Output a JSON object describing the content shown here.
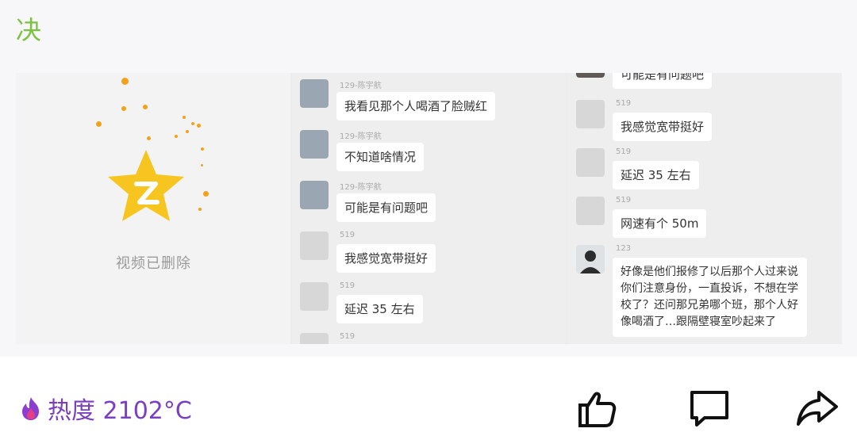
{
  "top": {
    "char": "决"
  },
  "video": {
    "deleted_text": "视频已删除"
  },
  "chat_left": [
    {
      "sender": "129-陈宇航",
      "text": "我看见那个人喝酒了脸贼红",
      "avatar": "photo-avatar"
    },
    {
      "sender": "129-陈宇航",
      "text": "不知道啥情况",
      "avatar": "photo-avatar"
    },
    {
      "sender": "129-陈宇航",
      "text": "可能是有问题吧",
      "avatar": "photo-avatar"
    },
    {
      "sender": "519",
      "text": "我感觉宽带挺好",
      "avatar": "sketch-avatar"
    },
    {
      "sender": "519",
      "text": "延迟 35 左右",
      "avatar": "sketch-avatar"
    },
    {
      "sender": "519",
      "text": "",
      "avatar": "sketch-avatar"
    }
  ],
  "chat_right": [
    {
      "sender": "",
      "text": "可能是有问题吧",
      "avatar": "photo-avatar"
    },
    {
      "sender": "519",
      "text": "我感觉宽带挺好",
      "avatar": "sketch-avatar"
    },
    {
      "sender": "519",
      "text": "延迟 35 左右",
      "avatar": "sketch-avatar"
    },
    {
      "sender": "519",
      "text": "网速有个 50m",
      "avatar": "sketch-avatar"
    },
    {
      "sender": "123",
      "text": "好像是他们报修了以后那个人过来说你们注意身份，一直投诉，不想在学校了？还问那兄弟哪个班，那个人好像喝酒了…跟隔壁寝室吵起来了",
      "avatar": "person-avatar"
    }
  ],
  "footer": {
    "heat_label": "热度 2102°C",
    "heat_icon": "flame-icon",
    "like_icon": "thumbs-up-icon",
    "comment_icon": "comment-icon",
    "share_icon": "share-icon"
  },
  "colors": {
    "accent_green": "#7cc241",
    "heat_purple": "#7a3fc0",
    "star_yellow": "#f7c520"
  }
}
